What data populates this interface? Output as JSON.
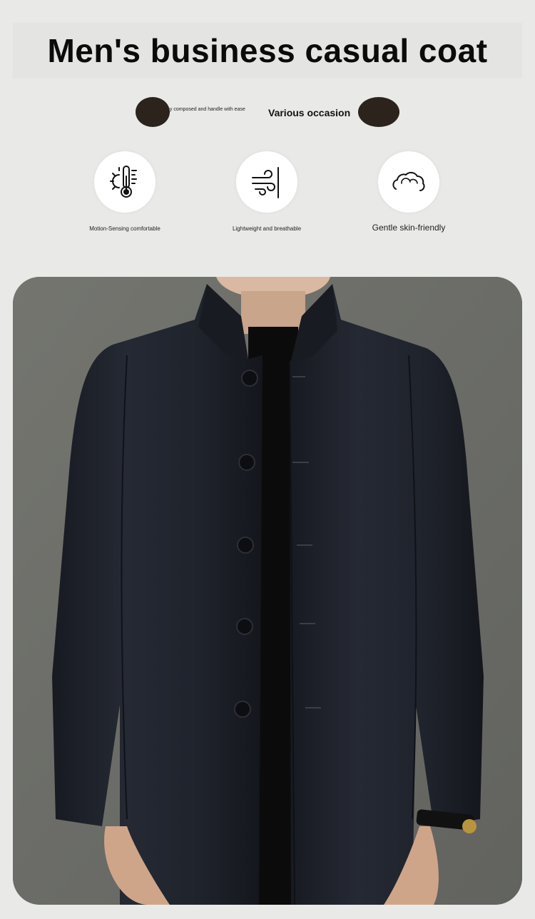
{
  "header": {
    "title": "Men's business casual coat"
  },
  "tagline": {
    "small_text": "ay composed and handle with ease",
    "big_text": "Various occasion"
  },
  "features": [
    {
      "icon": "thermometer-icon",
      "label": "Motion-Sensing comfortable"
    },
    {
      "icon": "wind-icon",
      "label": "Lightweight and breathable"
    },
    {
      "icon": "cloud-icon",
      "label": "Gentle skin-friendly"
    }
  ],
  "colors": {
    "background": "#e9e9e7",
    "photo_backdrop": "#6f706c",
    "jacket": "#1e2129",
    "title_text": "#0b0b0b"
  }
}
